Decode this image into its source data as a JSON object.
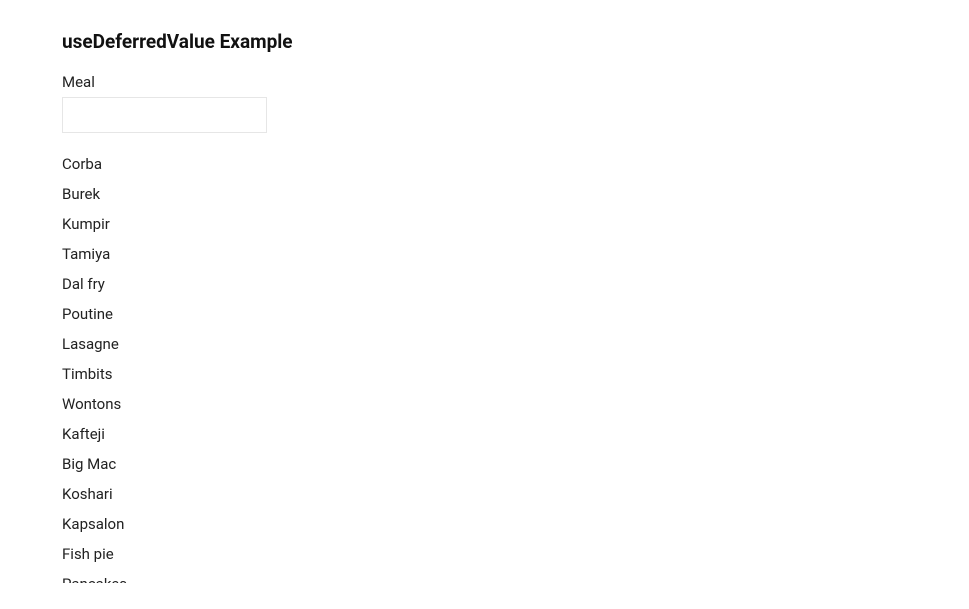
{
  "heading": "useDeferredValue Example",
  "form": {
    "label": "Meal",
    "input_value": "",
    "input_placeholder": ""
  },
  "meals": [
    "Corba",
    "Burek",
    "Kumpir",
    "Tamiya",
    "Dal fry",
    "Poutine",
    "Lasagne",
    "Timbits",
    "Wontons",
    "Kafteji",
    "Big Mac",
    "Koshari",
    "Kapsalon",
    "Fish pie",
    "Pancakes"
  ]
}
